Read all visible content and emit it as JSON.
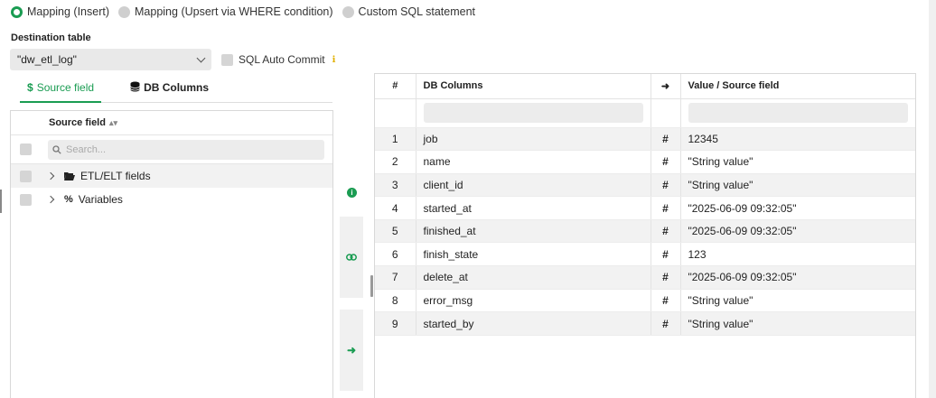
{
  "mapping_mode": {
    "options": [
      {
        "label": "Mapping (Insert)",
        "selected": true
      },
      {
        "label": "Mapping (Upsert via WHERE condition)",
        "selected": false
      },
      {
        "label": "Custom SQL statement",
        "selected": false
      }
    ]
  },
  "destination": {
    "label": "Destination table",
    "value": "\"dw_etl_log\""
  },
  "auto_commit": {
    "label": "SQL Auto Commit",
    "checked": false,
    "info_icon": "info-icon"
  },
  "tabs": [
    {
      "label": "Source field",
      "icon": "dollar-icon",
      "active": true
    },
    {
      "label": "DB Columns",
      "icon": "database-icon",
      "active": false
    }
  ],
  "source_panel": {
    "header": "Source field",
    "search_placeholder": "Search...",
    "items": [
      {
        "label": "ETL/ELT fields",
        "icon": "folder-open-icon"
      },
      {
        "label": "Variables",
        "icon": "percent-icon"
      }
    ]
  },
  "grid": {
    "headers": {
      "num": "#",
      "db": "DB Columns",
      "arrow": "➜",
      "value": "Value / Source field"
    },
    "rows": [
      {
        "num": "1",
        "db": "job",
        "type": "#",
        "value": "12345"
      },
      {
        "num": "2",
        "db": "name",
        "type": "#",
        "value": "\"String value\""
      },
      {
        "num": "3",
        "db": "client_id",
        "type": "#",
        "value": "\"String value\""
      },
      {
        "num": "4",
        "db": "started_at",
        "type": "#",
        "value": "\"2025-06-09 09:32:05\""
      },
      {
        "num": "5",
        "db": "finished_at",
        "type": "#",
        "value": "\"2025-06-09 09:32:05\""
      },
      {
        "num": "6",
        "db": "finish_state",
        "type": "#",
        "value": "123"
      },
      {
        "num": "7",
        "db": "delete_at",
        "type": "#",
        "value": "\"2025-06-09 09:32:05\""
      },
      {
        "num": "8",
        "db": "error_msg",
        "type": "#",
        "value": "\"String value\""
      },
      {
        "num": "9",
        "db": "started_by",
        "type": "#",
        "value": "\"String value\""
      }
    ]
  },
  "colors": {
    "accent": "#1a9c52"
  }
}
